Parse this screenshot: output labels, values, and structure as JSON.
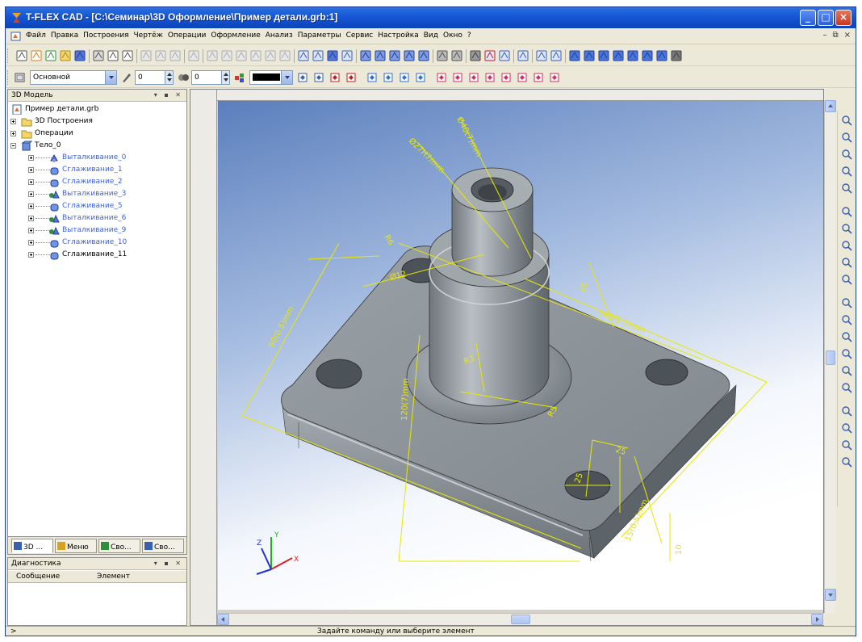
{
  "window": {
    "title": "T-FLEX CAD - [C:\\Семинар\\3D Оформление\\Пример детали.grb:1]",
    "min_glyph": "_",
    "max_glyph": "□",
    "close_glyph": "×"
  },
  "menu": {
    "items": [
      "Файл",
      "Правка",
      "Построения",
      "Чертёж",
      "Операции",
      "Оформление",
      "Анализ",
      "Параметры",
      "Сервис",
      "Настройка",
      "Вид",
      "Окно",
      "?"
    ],
    "mdi_controls": [
      "–",
      "⧉",
      "×"
    ]
  },
  "toolbar2": {
    "layer": "Основной",
    "spin1": "0",
    "spin2": "0"
  },
  "tree_panel": {
    "title": "3D Модель",
    "controls": "▾ ▪ ✕",
    "items": [
      {
        "label": "Пример детали.grb",
        "level": 0,
        "expand": "none",
        "icon": "doc",
        "blue": false
      },
      {
        "label": "3D Построения",
        "level": 1,
        "expand": "plus",
        "icon": "folder",
        "blue": false
      },
      {
        "label": "Операции",
        "level": 1,
        "expand": "plus",
        "icon": "folder",
        "blue": false
      },
      {
        "label": "Тело_0",
        "level": 1,
        "expand": "minus",
        "icon": "body",
        "blue": false
      },
      {
        "label": "Выталкивание_0",
        "level": 2,
        "expand": "plus",
        "icon": "extrude",
        "blue": true
      },
      {
        "label": "Сглаживание_1",
        "level": 2,
        "expand": "plus",
        "icon": "fillet",
        "blue": true
      },
      {
        "label": "Сглаживание_2",
        "level": 2,
        "expand": "plus",
        "icon": "fillet",
        "blue": true
      },
      {
        "label": "Выталкивание_3",
        "level": 2,
        "expand": "plus",
        "icon": "extrude2",
        "blue": true
      },
      {
        "label": "Сглаживание_5",
        "level": 2,
        "expand": "plus",
        "icon": "fillet",
        "blue": true
      },
      {
        "label": "Выталкивание_6",
        "level": 2,
        "expand": "plus",
        "icon": "extrude2",
        "blue": true
      },
      {
        "label": "Выталкивание_9",
        "level": 2,
        "expand": "plus",
        "icon": "extrude2",
        "blue": true
      },
      {
        "label": "Сглаживание_10",
        "level": 2,
        "expand": "plus",
        "icon": "fillet",
        "blue": true
      },
      {
        "label": "Сглаживание_11",
        "level": 2,
        "expand": "plus",
        "icon": "fillet",
        "blue": false
      }
    ]
  },
  "panel_tabs": [
    "3D ...",
    "Меню",
    "Сво...",
    "Сво..."
  ],
  "diagnostics": {
    "title": "Диагностика",
    "controls": "▾ ▪ ✕",
    "col_message": "Сообщение",
    "col_element": "Элемент"
  },
  "viewport": {
    "axis_x": "X",
    "axis_y": "Y",
    "axis_z": "Z",
    "dims": [
      {
        "id": "d-phi27",
        "text": "Ø27H7/mm"
      },
      {
        "id": "d-phi40",
        "text": "Ø40(7)mm"
      },
      {
        "id": "d-r6",
        "text": "R6"
      },
      {
        "id": "d-phi12",
        "text": "Ø12"
      },
      {
        "id": "d-80",
        "text": "80(0.5)mm"
      },
      {
        "id": "d-140",
        "text": "140(0.5)mm"
      },
      {
        "id": "d-h45",
        "text": "45"
      },
      {
        "id": "d-r6b",
        "text": "R5"
      },
      {
        "id": "d-25",
        "text": "25"
      },
      {
        "id": "d-25b",
        "text": "25"
      },
      {
        "id": "d-15",
        "text": "15(0.5)mm"
      },
      {
        "id": "d-10",
        "text": "10"
      },
      {
        "id": "d-h120",
        "text": "120(7)mm"
      },
      {
        "id": "d-r3",
        "text": "R3"
      }
    ]
  },
  "status": {
    "left": ">",
    "message": "Задайте команду или выберите элемент"
  },
  "colors": {
    "model_face": "#8e969c",
    "dimension": "#e8e800",
    "bg_top": "#6a8cc4",
    "bg_bottom": "#ffffff"
  }
}
